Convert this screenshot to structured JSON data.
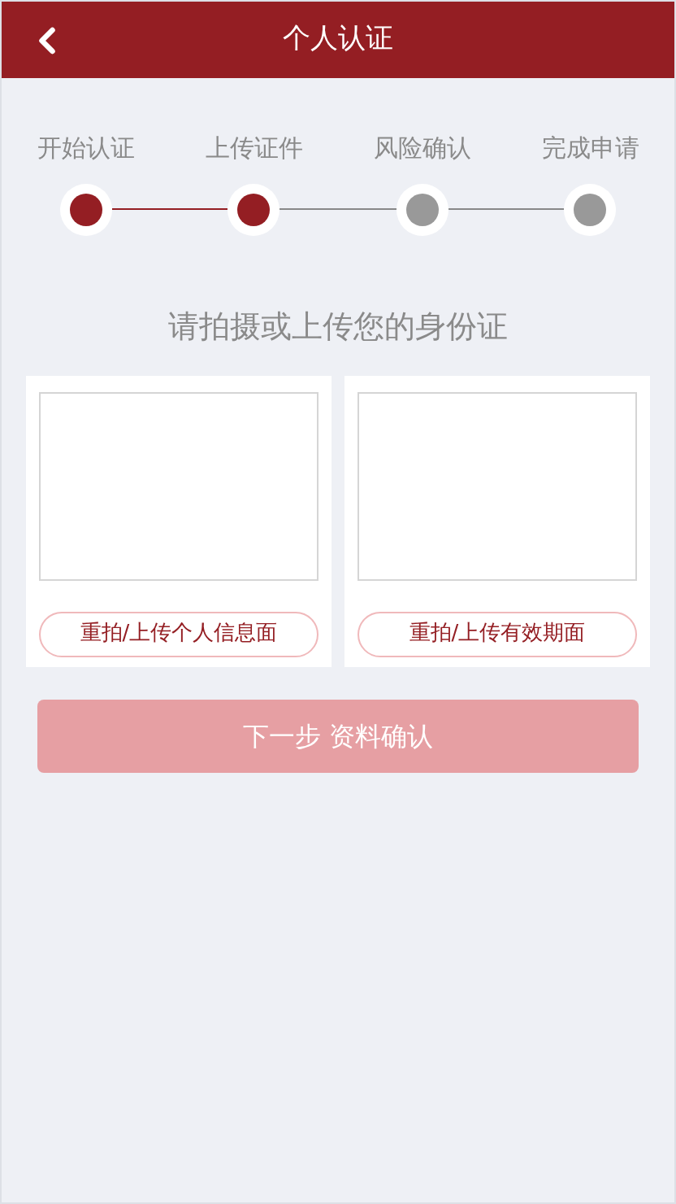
{
  "header": {
    "title": "个人认证"
  },
  "steps": [
    {
      "label": "开始认证",
      "done": true
    },
    {
      "label": "上传证件",
      "done": true
    },
    {
      "label": "风险确认",
      "done": false
    },
    {
      "label": "完成申请",
      "done": false
    }
  ],
  "heading": "请拍摄或上传您的身份证",
  "cards": [
    {
      "button": "重拍/上传个人信息面"
    },
    {
      "button": "重拍/上传有效期面"
    }
  ],
  "next_button": {
    "label": "下一步 资料确认",
    "disabled": true
  }
}
